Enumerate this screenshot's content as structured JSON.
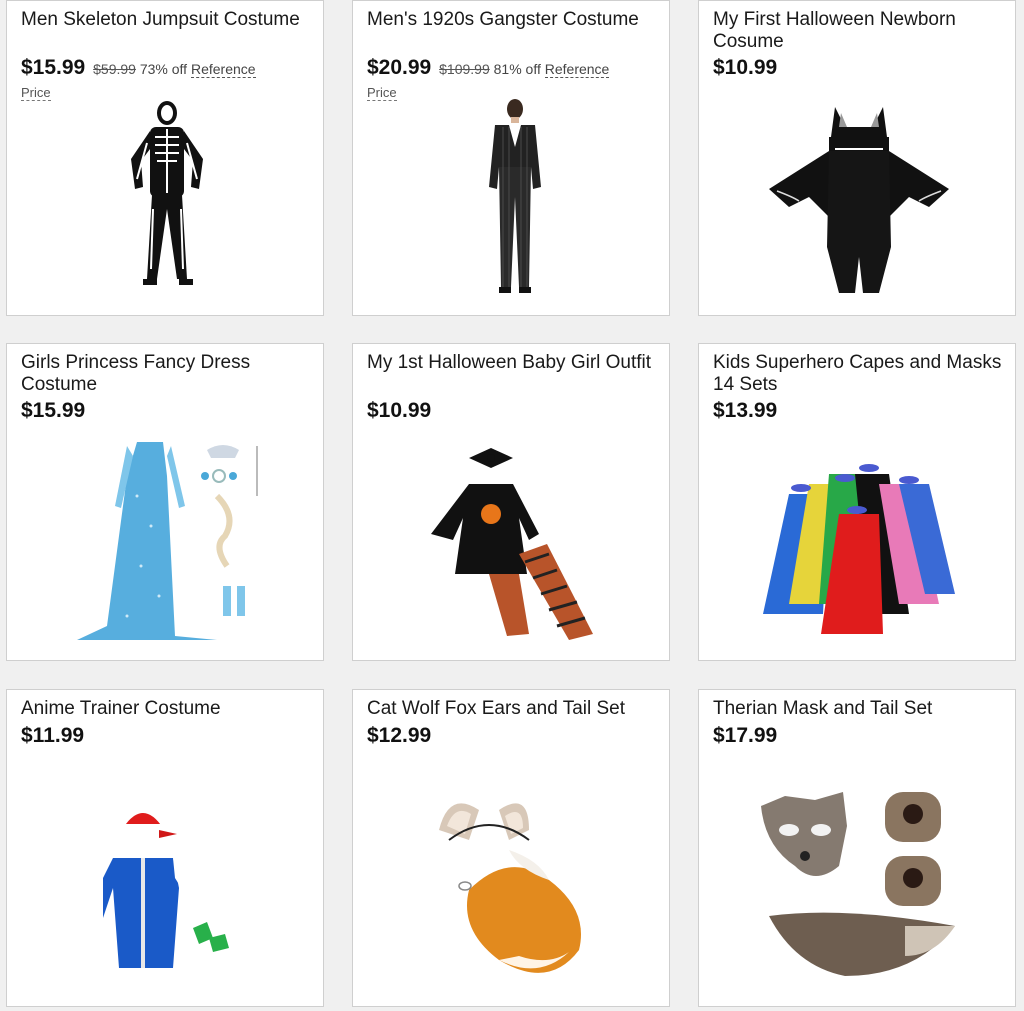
{
  "products": [
    {
      "title": "Men Skeleton Jumpsuit Costume",
      "price": "$15.99",
      "was": "$59.99",
      "discount": "73% off",
      "ref1": "Reference",
      "ref2": "Price",
      "image": "skeleton-jumpsuit-image"
    },
    {
      "title": "Men's 1920s Gangster Costume",
      "price": "$20.99",
      "was": "$109.99",
      "discount": "81% off",
      "ref1": "Reference",
      "ref2": "Price",
      "image": "gangster-suit-image"
    },
    {
      "title": "My First Halloween Newborn Cosume",
      "price": "$10.99",
      "image": "bat-onesie-image"
    },
    {
      "title": "Girls Princess Fancy Dress Costume",
      "price": "$15.99",
      "image": "princess-dress-image"
    },
    {
      "title": "My 1st Halloween Baby Girl Outfit",
      "price": "$10.99",
      "image": "baby-girl-outfit-image"
    },
    {
      "title": "Kids Superhero Capes and Masks 14 Sets",
      "price": "$13.99",
      "image": "superhero-capes-image"
    },
    {
      "title": "Anime Trainer Costume",
      "price": "$11.99",
      "image": "trainer-costume-image"
    },
    {
      "title": "Cat Wolf Fox Ears and Tail Set",
      "price": "$12.99",
      "image": "ears-tail-image"
    },
    {
      "title": "Therian Mask and Tail Set",
      "price": "$17.99",
      "image": "therian-mask-image"
    }
  ]
}
